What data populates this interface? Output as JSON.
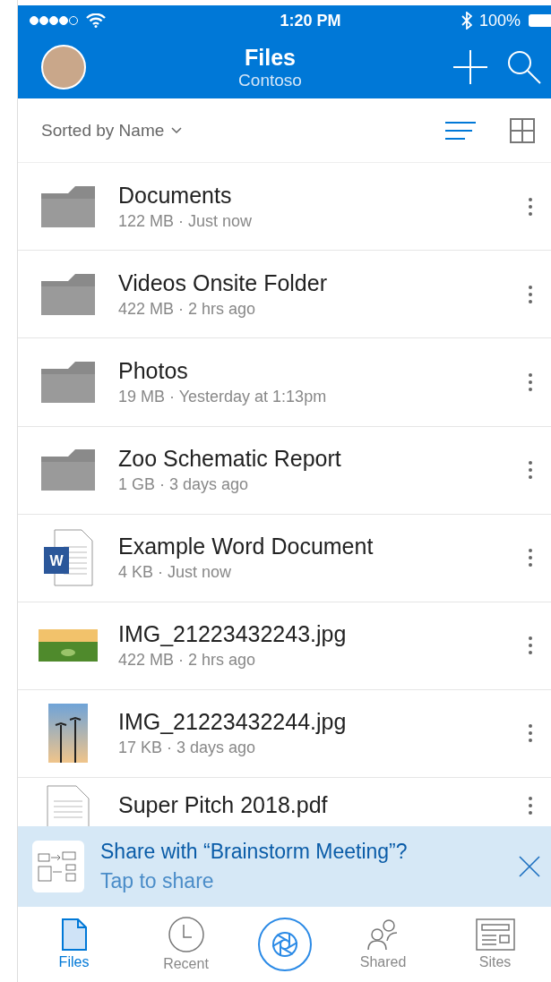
{
  "status_bar": {
    "time": "1:20 PM",
    "battery": "100%"
  },
  "header": {
    "title": "Files",
    "subtitle": "Contoso"
  },
  "sort": {
    "label": "Sorted by Name",
    "views": [
      {
        "kind": "list",
        "selected": true
      },
      {
        "kind": "grid",
        "selected": false
      }
    ]
  },
  "files": [
    {
      "kind": "folder",
      "name": "Documents",
      "meta": "122 MB · Just now"
    },
    {
      "kind": "folder",
      "name": "Videos Onsite Folder",
      "meta": "422 MB · 2 hrs ago"
    },
    {
      "kind": "folder",
      "name": "Photos",
      "meta": "19 MB · Yesterday at 1:13pm"
    },
    {
      "kind": "folder",
      "name": "Zoo Schematic Report",
      "meta": "1 GB · 3 days ago"
    },
    {
      "kind": "word",
      "name": "Example Word Document",
      "meta": "4 KB · Just now",
      "icon_letter": "W"
    },
    {
      "kind": "landscape",
      "name": "IMG_21223432243.jpg",
      "meta": "422 MB · 2 hrs ago"
    },
    {
      "kind": "portrait",
      "name": "IMG_21223432244.jpg",
      "meta": "17 KB · 3 days ago"
    },
    {
      "kind": "pdf",
      "name": "Super Pitch 2018.pdf"
    }
  ],
  "share_banner": {
    "title": "Share with “Brainstorm Meeting”?",
    "subtitle": "Tap to share"
  },
  "tabs": [
    {
      "kind": "files",
      "label": "Files",
      "selected": true
    },
    {
      "kind": "recent",
      "label": "Recent",
      "selected": false
    },
    {
      "kind": "camera",
      "selected": false
    },
    {
      "kind": "shared",
      "label": "Shared",
      "selected": false
    },
    {
      "kind": "sites",
      "label": "Sites",
      "selected": false
    }
  ]
}
